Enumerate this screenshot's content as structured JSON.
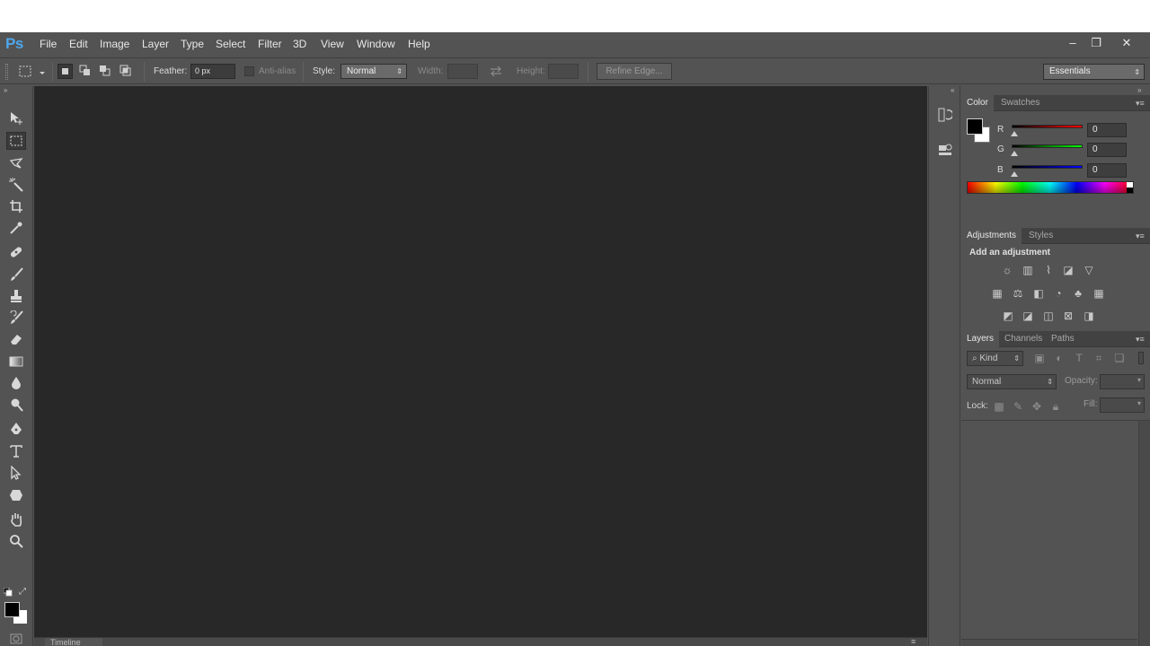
{
  "app": {
    "logo": "Ps"
  },
  "menu": [
    "File",
    "Edit",
    "Image",
    "Layer",
    "Type",
    "Select",
    "Filter",
    "3D",
    "View",
    "Window",
    "Help"
  ],
  "window_controls": {
    "minimize": "–",
    "restore": "❐",
    "close": "✕"
  },
  "options": {
    "feather_label": "Feather:",
    "feather_value": "0 px",
    "antialias_label": "Anti-alias",
    "style_label": "Style:",
    "style_value": "Normal",
    "width_label": "Width:",
    "height_label": "Height:",
    "refine_edge_label": "Refine Edge...",
    "workspace_value": "Essentials"
  },
  "timeline": {
    "label": "Timeline"
  },
  "color_panel": {
    "tabs": [
      "Color",
      "Swatches"
    ],
    "r_label": "R",
    "g_label": "G",
    "b_label": "B",
    "r_value": "0",
    "g_value": "0",
    "b_value": "0",
    "foreground_color": "#000000",
    "background_color": "#ffffff"
  },
  "adjustments_panel": {
    "tabs": [
      "Adjustments",
      "Styles"
    ],
    "heading": "Add an adjustment"
  },
  "layers_panel": {
    "tabs": [
      "Layers",
      "Channels",
      "Paths"
    ],
    "kind_label": "Kind",
    "blend_mode": "Normal",
    "opacity_label": "Opacity:",
    "lock_label": "Lock:",
    "fill_label": "Fill:"
  }
}
